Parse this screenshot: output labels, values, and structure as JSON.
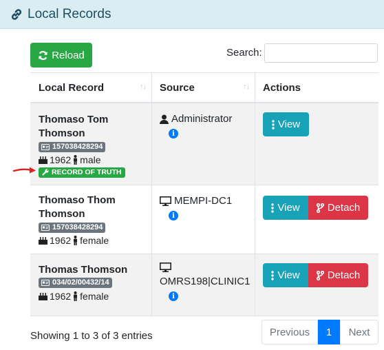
{
  "header": {
    "title": "Local Records"
  },
  "toolbar": {
    "reload_label": "Reload",
    "search_label": "Search:",
    "search_value": ""
  },
  "table": {
    "columns": [
      "Local Record",
      "Source",
      "Actions"
    ],
    "rows": [
      {
        "name": "Thomaso Tom Thomson",
        "id": "157038428294",
        "year": "1962",
        "gender": "male",
        "truth_badge": "RECORD OF TRUTH",
        "source": "Administrator",
        "view_label": "View"
      },
      {
        "name": "Thomaso Thom Thomson",
        "id": "157038428294",
        "year": "1962",
        "gender": "female",
        "source": "MEMPI-DC1",
        "view_label": "View",
        "detach_label": "Detach"
      },
      {
        "name": "Thomas Thomson",
        "id": "034/02/00432/14",
        "year": "1962",
        "gender": "female",
        "source": "OMRS198|CLINIC1",
        "view_label": "View",
        "detach_label": "Detach"
      }
    ]
  },
  "footer": {
    "info": "Showing 1 to 3 of 3 entries",
    "previous": "Previous",
    "page": "1",
    "next": "Next"
  },
  "colors": {
    "header_bg": "#d9edf2",
    "reload": "#28a745",
    "view": "#17a2b8",
    "detach": "#dc3545",
    "page_active": "#007bff"
  }
}
